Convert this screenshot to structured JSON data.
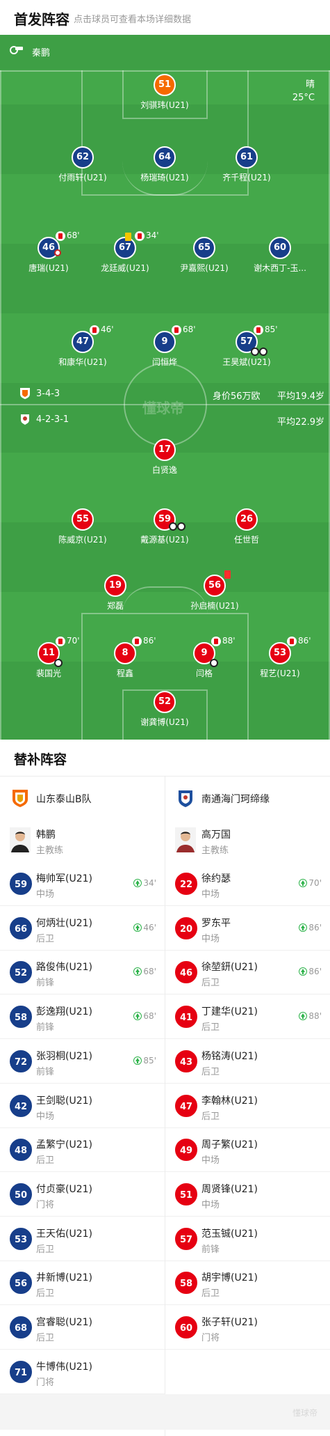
{
  "header": {
    "title": "首发阵容",
    "subtitle": "点击球员可查看本场详细数据"
  },
  "referee": {
    "name": "秦鹏",
    "icon": "whistle-icon"
  },
  "weather": {
    "condition": "晴",
    "temperature": "25°C"
  },
  "watermark": "懂球帝",
  "home_team": {
    "formation": "3-4-3",
    "value": "身价56万欧",
    "avg_age": "平均19.4岁"
  },
  "away_team": {
    "formation": "4-2-3-1",
    "avg_age": "平均22.9岁"
  },
  "home_lineup": [
    {
      "num": "51",
      "name": "刘骐玮(U21)",
      "color": "orange"
    },
    {
      "num": "62",
      "name": "付雨轩(U21)",
      "color": "navy"
    },
    {
      "num": "64",
      "name": "杨瑞琦(U21)",
      "color": "navy"
    },
    {
      "num": "61",
      "name": "齐千程(U21)",
      "color": "navy"
    },
    {
      "num": "46",
      "name": "唐瑞(U21)",
      "color": "navy",
      "sub_out": "68'"
    },
    {
      "num": "67",
      "name": "龙廷威(U21)",
      "color": "navy",
      "sub_out": "34'"
    },
    {
      "num": "65",
      "name": "尹嘉熙(U21)",
      "color": "navy"
    },
    {
      "num": "60",
      "name": "谢木西丁-玉...",
      "color": "navy"
    },
    {
      "num": "47",
      "name": "和康华(U21)",
      "color": "navy",
      "sub_out": "46'"
    },
    {
      "num": "9",
      "name": "闫恒烨",
      "color": "navy",
      "sub_out": "68'"
    },
    {
      "num": "57",
      "name": "王昊斌(U21)",
      "color": "navy",
      "sub_out": "85'"
    }
  ],
  "away_lineup": [
    {
      "num": "17",
      "name": "白贤逸",
      "color": "red"
    },
    {
      "num": "55",
      "name": "陈威京(U21)",
      "color": "red"
    },
    {
      "num": "59",
      "name": "戴源基(U21)",
      "color": "red"
    },
    {
      "num": "26",
      "name": "任世哲",
      "color": "red"
    },
    {
      "num": "19",
      "name": "郑磊",
      "color": "red"
    },
    {
      "num": "56",
      "name": "孙启楠(U21)",
      "color": "red"
    },
    {
      "num": "11",
      "name": "裴国光",
      "color": "red",
      "sub_out": "70'"
    },
    {
      "num": "8",
      "name": "程鑫",
      "color": "red",
      "sub_out": "86'"
    },
    {
      "num": "9",
      "name": "闫格",
      "color": "red",
      "sub_out": "88'"
    },
    {
      "num": "53",
      "name": "程艺(U21)",
      "color": "red",
      "sub_out": "86'"
    },
    {
      "num": "52",
      "name": "谢龚博(U21)",
      "color": "red"
    }
  ],
  "subs": {
    "title": "替补阵容",
    "home": {
      "team": "山东泰山B队",
      "coach": {
        "name": "韩鹏",
        "role": "主教练"
      },
      "players": [
        {
          "num": "59",
          "name": "梅帅军(U21)",
          "pos": "中场",
          "in": "34'"
        },
        {
          "num": "66",
          "name": "何炳壮(U21)",
          "pos": "后卫",
          "in": "46'"
        },
        {
          "num": "52",
          "name": "路俊伟(U21)",
          "pos": "前锋",
          "in": "68'"
        },
        {
          "num": "58",
          "name": "彭逸翔(U21)",
          "pos": "前锋",
          "in": "68'"
        },
        {
          "num": "72",
          "name": "张羽桐(U21)",
          "pos": "前锋",
          "in": "85'"
        },
        {
          "num": "42",
          "name": "王剑聪(U21)",
          "pos": "中场"
        },
        {
          "num": "48",
          "name": "孟繁宁(U21)",
          "pos": "后卫"
        },
        {
          "num": "50",
          "name": "付贞豪(U21)",
          "pos": "门将"
        },
        {
          "num": "53",
          "name": "王天佑(U21)",
          "pos": "后卫"
        },
        {
          "num": "56",
          "name": "井新博(U21)",
          "pos": "后卫"
        },
        {
          "num": "68",
          "name": "宫睿聪(U21)",
          "pos": "后卫"
        },
        {
          "num": "71",
          "name": "牛博伟(U21)",
          "pos": "门将"
        }
      ]
    },
    "away": {
      "team": "南通海门珂缔缘",
      "coach": {
        "name": "高万国",
        "role": "主教练"
      },
      "players": [
        {
          "num": "22",
          "name": "徐约瑟",
          "pos": "中场",
          "in": "70'"
        },
        {
          "num": "20",
          "name": "罗东平",
          "pos": "中场",
          "in": "86'"
        },
        {
          "num": "46",
          "name": "徐堃鈃(U21)",
          "pos": "后卫",
          "in": "86'"
        },
        {
          "num": "41",
          "name": "丁建华(U21)",
          "pos": "后卫",
          "in": "88'"
        },
        {
          "num": "43",
          "name": "杨铭涛(U21)",
          "pos": "后卫"
        },
        {
          "num": "47",
          "name": "李翰林(U21)",
          "pos": "后卫"
        },
        {
          "num": "49",
          "name": "周子繁(U21)",
          "pos": "中场"
        },
        {
          "num": "51",
          "name": "周贤锋(U21)",
          "pos": "中场"
        },
        {
          "num": "57",
          "name": "范玉铖(U21)",
          "pos": "前锋"
        },
        {
          "num": "58",
          "name": "胡宇博(U21)",
          "pos": "后卫"
        },
        {
          "num": "60",
          "name": "张子轩(U21)",
          "pos": "门将"
        }
      ]
    }
  },
  "colors": {
    "pitch": "#44a84a",
    "home_accent": "#173e8a",
    "away_accent": "#e60012",
    "gk_home": "#f56a00",
    "sub_in": "#2db34a"
  }
}
